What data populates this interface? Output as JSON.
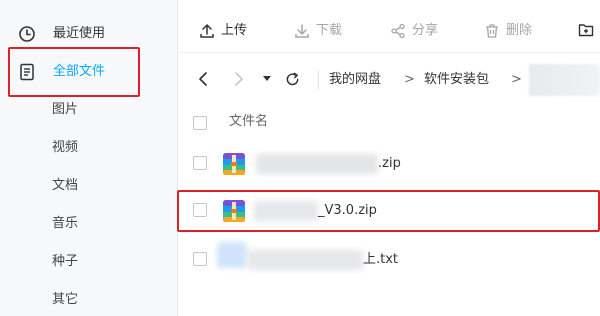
{
  "sidebar": {
    "items": [
      {
        "label": "最近使用",
        "icon": "clock-icon"
      },
      {
        "label": "全部文件",
        "icon": "document-icon",
        "active": true
      },
      {
        "label": "图片"
      },
      {
        "label": "视频"
      },
      {
        "label": "文档"
      },
      {
        "label": "音乐"
      },
      {
        "label": "种子"
      },
      {
        "label": "其它"
      }
    ]
  },
  "toolbar": {
    "upload": "上传",
    "download": "下载",
    "share": "分享",
    "delete": "删除"
  },
  "path": {
    "crumbs": [
      "我的网盘",
      "软件安装包"
    ],
    "separator": ">"
  },
  "list": {
    "column_name": "文件名",
    "files": [
      {
        "name_visible": ".zip",
        "type": "zip"
      },
      {
        "name_visible": "_V3.0.zip",
        "type": "zip",
        "highlighted": true
      },
      {
        "name_visible": "上.txt",
        "type": "txt"
      }
    ]
  },
  "colors": {
    "accent": "#06a7ff",
    "highlight_border": "#d9222a",
    "sidebar_bg": "#f7f8fa"
  }
}
